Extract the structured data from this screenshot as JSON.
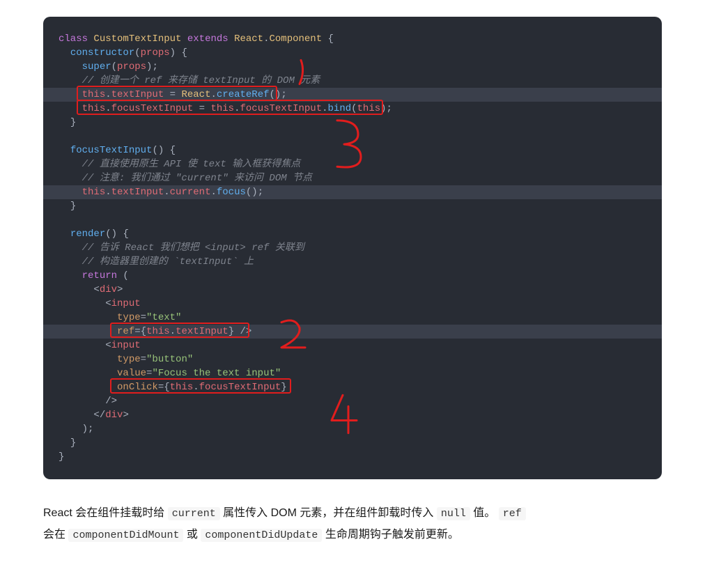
{
  "code": {
    "l1": {
      "kw1": "class",
      "cls": "CustomTextInput",
      "kw2": "extends",
      "ns": "React",
      "comp": "Component",
      "brace": "{"
    },
    "l2": {
      "fn": "constructor",
      "arg": "props",
      "rest": ") {"
    },
    "l3": {
      "kw": "super",
      "arg": "props",
      "rest": ");"
    },
    "l4": {
      "cmt": "// 创建一个 ref 来存储 textInput 的 DOM 元素"
    },
    "l5": {
      "this": "this",
      "prop": "textInput",
      "eq": " = ",
      "ns": "React",
      "fn": "createRef",
      "rest": "();"
    },
    "l6": {
      "this1": "this",
      "prop1": "focusTextInput",
      "eq": " = ",
      "this2": "this",
      "prop2": "focusTextInput",
      "fn": "bind",
      "this3": "this",
      "rest": ");"
    },
    "l7": {
      "brace": "}"
    },
    "l8": {
      "blank": ""
    },
    "l9": {
      "fn": "focusTextInput",
      "rest": "() {"
    },
    "l10": {
      "cmt": "// 直接使用原生 API 使 text 输入框获得焦点"
    },
    "l11": {
      "cmt": "// 注意: 我们通过 \"current\" 来访问 DOM 节点"
    },
    "l12": {
      "this": "this",
      "p1": "textInput",
      "p2": "current",
      "fn": "focus",
      "rest": "();"
    },
    "l13": {
      "brace": "}"
    },
    "l14": {
      "blank": ""
    },
    "l15": {
      "fn": "render",
      "rest": "() {"
    },
    "l16": {
      "cmt": "// 告诉 React 我们想把 <input> ref 关联到"
    },
    "l17": {
      "cmt": "// 构造器里创建的 `textInput` 上"
    },
    "l18": {
      "kw": "return",
      "rest": " ("
    },
    "l19": {
      "open": "<",
      "tag": "div",
      "close": ">"
    },
    "l20": {
      "open": "<",
      "tag": "input"
    },
    "l21": {
      "attr": "type",
      "eq": "=",
      "val": "\"text\""
    },
    "l22": {
      "attr": "ref",
      "eq": "=",
      "brace1": "{",
      "this": "this",
      "prop": "textInput",
      "brace2": "}",
      "end": " />"
    },
    "l23": {
      "open": "<",
      "tag": "input"
    },
    "l24": {
      "attr": "type",
      "eq": "=",
      "val": "\"button\""
    },
    "l25": {
      "attr": "value",
      "eq": "=",
      "val": "\"Focus the text input\""
    },
    "l26": {
      "attr": "onClick",
      "eq": "=",
      "brace1": "{",
      "this": "this",
      "prop": "focusTextInput",
      "brace2": "}"
    },
    "l27": {
      "end": "/>"
    },
    "l28": {
      "open": "</",
      "tag": "div",
      "close": ">"
    },
    "l29": {
      "rest": ");"
    },
    "l30": {
      "brace": "}"
    },
    "l31": {
      "brace": "}"
    }
  },
  "annotations": {
    "n3": "3",
    "n2": "2",
    "n4": "4"
  },
  "prose": {
    "p1a": "React 会在组件挂载时给 ",
    "p1code1": "current",
    "p1b": " 属性传入 DOM 元素，并在组件卸载时传入 ",
    "p1code2": "null",
    "p1c": " 值。 ",
    "p1code3": "ref",
    "p2a": "会在 ",
    "p2code1": "componentDidMount",
    "p2b": " 或 ",
    "p2code2": "componentDidUpdate",
    "p2c": " 生命周期钩子触发前更新。"
  }
}
